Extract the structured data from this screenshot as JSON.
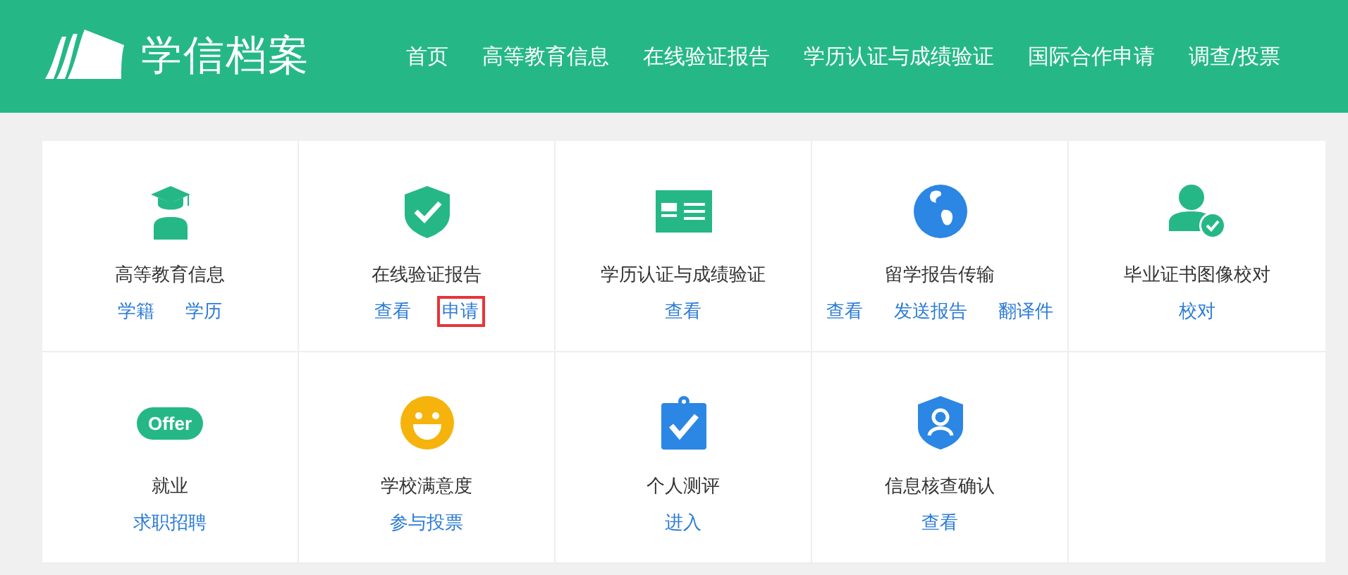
{
  "header": {
    "logo_text": "学信档案",
    "nav": [
      {
        "label": "首页"
      },
      {
        "label": "高等教育信息"
      },
      {
        "label": "在线验证报告"
      },
      {
        "label": "学历认证与成绩验证"
      },
      {
        "label": "国际合作申请"
      },
      {
        "label": "调查/投票"
      }
    ]
  },
  "services": [
    {
      "kind": "graduate",
      "title": "高等教育信息",
      "links": [
        {
          "label": "学籍",
          "highlighted": false
        },
        {
          "label": "学历",
          "highlighted": false
        }
      ]
    },
    {
      "kind": "shield",
      "title": "在线验证报告",
      "links": [
        {
          "label": "查看",
          "highlighted": false
        },
        {
          "label": "申请",
          "highlighted": true
        }
      ]
    },
    {
      "kind": "card",
      "title": "学历认证与成绩验证",
      "links": [
        {
          "label": "查看",
          "highlighted": false
        }
      ]
    },
    {
      "kind": "globe",
      "title": "留学报告传输",
      "links": [
        {
          "label": "查看",
          "highlighted": false
        },
        {
          "label": "发送报告",
          "highlighted": false
        },
        {
          "label": "翻译件",
          "highlighted": false
        }
      ]
    },
    {
      "kind": "person",
      "title": "毕业证书图像校对",
      "links": [
        {
          "label": "校对",
          "highlighted": false
        }
      ]
    },
    {
      "kind": "offer",
      "icon_text": "Offer",
      "title": "就业",
      "links": [
        {
          "label": "求职招聘",
          "highlighted": false
        }
      ]
    },
    {
      "kind": "smile",
      "title": "学校满意度",
      "links": [
        {
          "label": "参与投票",
          "highlighted": false
        }
      ]
    },
    {
      "kind": "clipboard",
      "title": "个人测评",
      "links": [
        {
          "label": "进入",
          "highlighted": false
        }
      ]
    },
    {
      "kind": "badge",
      "title": "信息核查确认",
      "links": [
        {
          "label": "查看",
          "highlighted": false
        }
      ]
    }
  ]
}
